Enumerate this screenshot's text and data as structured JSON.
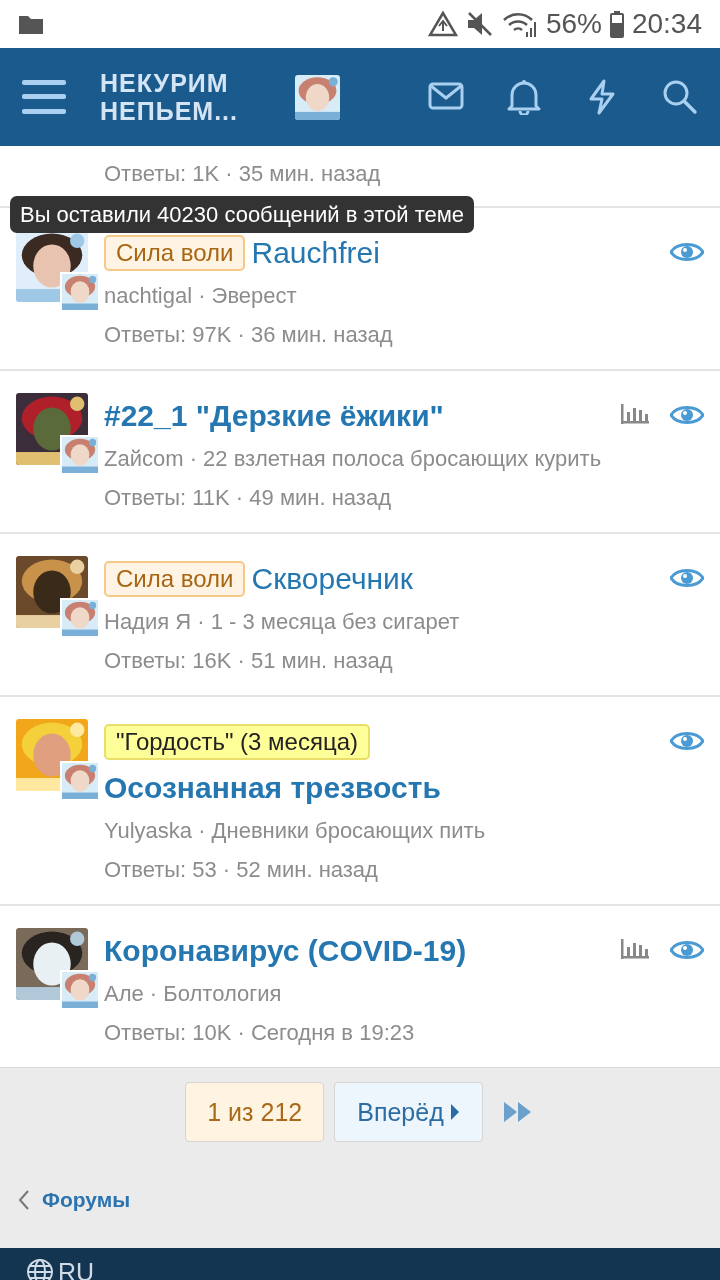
{
  "status_bar": {
    "battery": "56%",
    "time": "20:34"
  },
  "header": {
    "logo_lines": [
      "НЕКУРИМ",
      "НЕПЬЕМ..."
    ]
  },
  "partial_thread": {
    "stats": "Ответы: 1K · 35 мин. назад"
  },
  "tooltip": "Вы оставили 40230 сообщений в этой теме",
  "threads": [
    {
      "prefix": {
        "label": "Сила воли",
        "kind": "orange"
      },
      "title": "Rauchfrei",
      "byline": "nachtigal · Эверест",
      "stats": "Ответы: 97K · 36 мин. назад",
      "poll": false,
      "watched": true
    },
    {
      "title": "#22_1 \"Дерзкие ёжики\"",
      "byline": "Zaйcom · 22 взлетная полоса бросающих курить",
      "stats": "Ответы: 11K · 49 мин. назад",
      "poll": true,
      "watched": true
    },
    {
      "prefix": {
        "label": "Сила воли",
        "kind": "orange"
      },
      "title": "Скворечник",
      "byline": "Надия Я · 1 - 3 месяца без сигарет",
      "stats": "Ответы: 16K · 51 мин. назад",
      "poll": false,
      "watched": true
    },
    {
      "prefix": {
        "label": "\"Гордость\" (3 месяца)",
        "kind": "yellow"
      },
      "title": "Осознанная трезвость",
      "byline": "Yulyaska · Дневники бросающих пить",
      "stats": "Ответы: 53 · 52 мин. назад",
      "poll": false,
      "watched": true
    },
    {
      "title": "Коронавирус (COVID-19)",
      "byline": "Але · Болтология",
      "stats": "Ответы: 10K · Сегодня в 19:23",
      "poll": true,
      "watched": true
    }
  ],
  "pagination": {
    "current": "1 из 212",
    "next": "Вперёд"
  },
  "breadcrumb": "Форумы",
  "footer": {
    "language": "RU"
  }
}
